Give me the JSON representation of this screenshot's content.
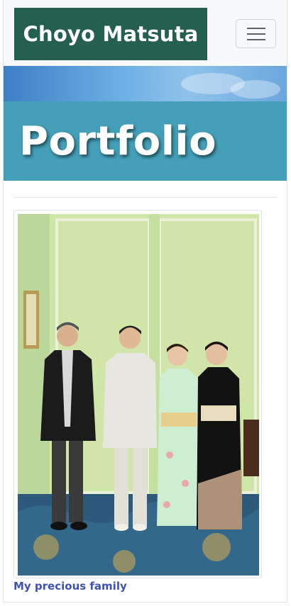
{
  "navbar": {
    "brand": "Choyo Matsuta",
    "toggle_icon": "hamburger-icon",
    "brand_color": "#245f50"
  },
  "hero": {
    "title": "Portfolio",
    "color": "#44a0b8"
  },
  "portfolio": {
    "items": [
      {
        "caption": "My precious family",
        "image_icon": "family-photo"
      }
    ]
  },
  "colors": {
    "link": "#3f51b5",
    "navbar_bg": "#f8f9fa"
  }
}
